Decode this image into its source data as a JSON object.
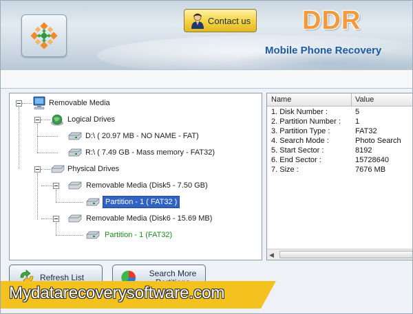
{
  "header": {
    "contact_label": "Contact us",
    "brand": "DDR",
    "subtitle": "Mobile Phone Recovery"
  },
  "tree": {
    "root": "Removable Media",
    "logical_drives": "Logical Drives",
    "drive_d": "D:\\ ( 20.97 MB - NO NAME - FAT)",
    "drive_r": "R:\\ (  7.49 GB - Mass memory - FAT32)",
    "physical_drives": "Physical Drives",
    "disk5": "Removable Media (Disk5 - 7.50 GB)",
    "disk5_partition": "Partition - 1 ( FAT32 )",
    "disk6": "Removable Media (Disk6 - 15.69 MB)",
    "disk6_partition": "Partition - 1 (FAT32)"
  },
  "properties": {
    "col_name": "Name",
    "col_value": "Value",
    "rows": [
      {
        "name": "1. Disk Number :",
        "value": "5"
      },
      {
        "name": "2. Partition Number :",
        "value": "1"
      },
      {
        "name": "3. Partition Type :",
        "value": "FAT32"
      },
      {
        "name": "4. Search Mode :",
        "value": "Photo Search"
      },
      {
        "name": "5. Start Sector :",
        "value": "8192"
      },
      {
        "name": "6. End Sector :",
        "value": "15728640"
      },
      {
        "name": "7. Size :",
        "value": "7676 MB"
      }
    ]
  },
  "buttons": {
    "refresh": "Refresh List",
    "search_more": "Search More Partitions"
  },
  "watermark": "Mydatarecoverysoftware.com",
  "colors": {
    "brand": "#f19a3e",
    "selection": "#3163c5",
    "watermark_bg": "#f3c21e"
  }
}
